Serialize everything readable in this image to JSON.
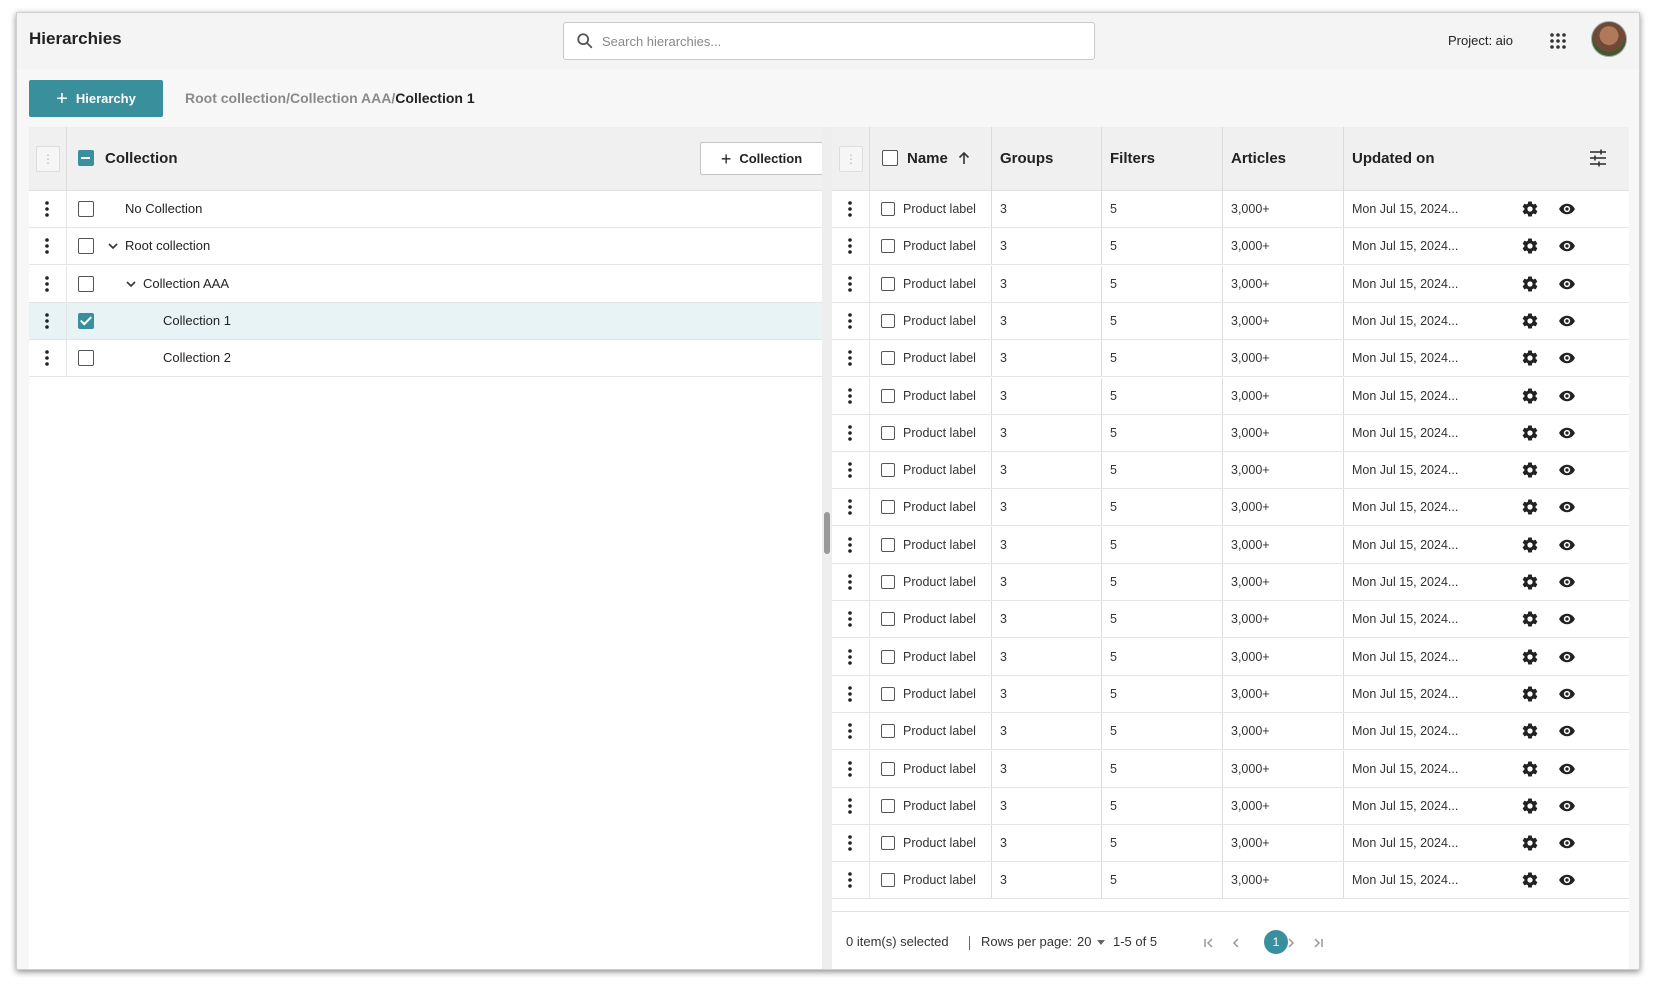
{
  "header": {
    "title": "Hierarchies",
    "search_placeholder": "Search hierarchies...",
    "project_label": "Project: aio",
    "apps_icon": "apps-grid-icon",
    "avatar": "user-avatar"
  },
  "toolbar": {
    "add_hierarchy_label": "Hierarchy",
    "breadcrumb": [
      "Root collection",
      "Collection AAA",
      "Collection 1"
    ],
    "breadcrumb_sep": "/"
  },
  "tree": {
    "header_label": "Collection",
    "add_collection_label": "Collection",
    "rows": [
      {
        "label": "No Collection",
        "checked": false,
        "expandable": false,
        "depth": 0
      },
      {
        "label": "Root collection",
        "checked": false,
        "expandable": true,
        "depth": 0
      },
      {
        "label": "Collection AAA",
        "checked": false,
        "expandable": true,
        "depth": 1
      },
      {
        "label": "Collection 1",
        "checked": true,
        "expandable": false,
        "depth": 2,
        "selected": true
      },
      {
        "label": "Collection 2",
        "checked": false,
        "expandable": false,
        "depth": 2
      }
    ]
  },
  "grid": {
    "columns": {
      "name": "Name",
      "groups": "Groups",
      "filters": "Filters",
      "articles": "Articles",
      "updated": "Updated on"
    },
    "sort": {
      "column": "name",
      "direction": "ascending"
    },
    "rows": [
      {
        "name": "Product label",
        "groups": "3",
        "filters": "5",
        "articles": "3,000+",
        "updated": "Mon Jul 15, 2024..."
      },
      {
        "name": "Product label",
        "groups": "3",
        "filters": "5",
        "articles": "3,000+",
        "updated": "Mon Jul 15, 2024..."
      },
      {
        "name": "Product label",
        "groups": "3",
        "filters": "5",
        "articles": "3,000+",
        "updated": "Mon Jul 15, 2024..."
      },
      {
        "name": "Product label",
        "groups": "3",
        "filters": "5",
        "articles": "3,000+",
        "updated": "Mon Jul 15, 2024..."
      },
      {
        "name": "Product label",
        "groups": "3",
        "filters": "5",
        "articles": "3,000+",
        "updated": "Mon Jul 15, 2024..."
      },
      {
        "name": "Product label",
        "groups": "3",
        "filters": "5",
        "articles": "3,000+",
        "updated": "Mon Jul 15, 2024..."
      },
      {
        "name": "Product label",
        "groups": "3",
        "filters": "5",
        "articles": "3,000+",
        "updated": "Mon Jul 15, 2024..."
      },
      {
        "name": "Product label",
        "groups": "3",
        "filters": "5",
        "articles": "3,000+",
        "updated": "Mon Jul 15, 2024..."
      },
      {
        "name": "Product label",
        "groups": "3",
        "filters": "5",
        "articles": "3,000+",
        "updated": "Mon Jul 15, 2024..."
      },
      {
        "name": "Product label",
        "groups": "3",
        "filters": "5",
        "articles": "3,000+",
        "updated": "Mon Jul 15, 2024..."
      },
      {
        "name": "Product label",
        "groups": "3",
        "filters": "5",
        "articles": "3,000+",
        "updated": "Mon Jul 15, 2024..."
      },
      {
        "name": "Product label",
        "groups": "3",
        "filters": "5",
        "articles": "3,000+",
        "updated": "Mon Jul 15, 2024..."
      },
      {
        "name": "Product label",
        "groups": "3",
        "filters": "5",
        "articles": "3,000+",
        "updated": "Mon Jul 15, 2024..."
      },
      {
        "name": "Product label",
        "groups": "3",
        "filters": "5",
        "articles": "3,000+",
        "updated": "Mon Jul 15, 2024..."
      },
      {
        "name": "Product label",
        "groups": "3",
        "filters": "5",
        "articles": "3,000+",
        "updated": "Mon Jul 15, 2024..."
      },
      {
        "name": "Product label",
        "groups": "3",
        "filters": "5",
        "articles": "3,000+",
        "updated": "Mon Jul 15, 2024..."
      },
      {
        "name": "Product label",
        "groups": "3",
        "filters": "5",
        "articles": "3,000+",
        "updated": "Mon Jul 15, 2024..."
      },
      {
        "name": "Product label",
        "groups": "3",
        "filters": "5",
        "articles": "3,000+",
        "updated": "Mon Jul 15, 2024..."
      },
      {
        "name": "Product label",
        "groups": "3",
        "filters": "5",
        "articles": "3,000+",
        "updated": "Mon Jul 15, 2024..."
      }
    ],
    "row_icons": [
      "gear-icon",
      "eye-icon"
    ]
  },
  "footer": {
    "selected_text": "0 item(s) selected",
    "rows_per_page_label": "Rows per page:",
    "rows_per_page_value": "20",
    "range_text": "1-5 of 5",
    "current_page": "1"
  },
  "colors": {
    "accent": "#3a8f9d",
    "selected_row": "#e8f3f5",
    "header_bg": "#f0f0f0"
  }
}
